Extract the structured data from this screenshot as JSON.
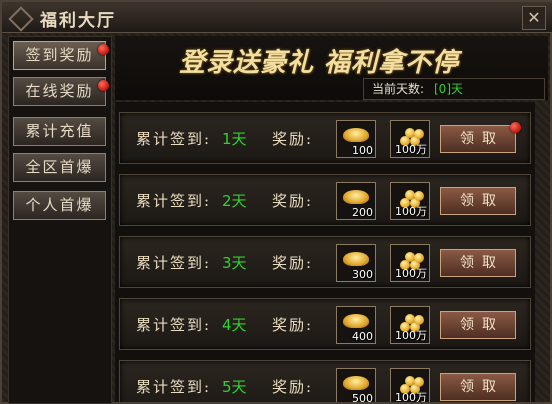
{
  "window": {
    "title": "福利大厅"
  },
  "nav": {
    "items": [
      {
        "label": "签到奖励",
        "badge": true
      },
      {
        "label": "在线奖励",
        "badge": true
      },
      {
        "label": "累计充值",
        "badge": false
      },
      {
        "label": "全区首爆",
        "badge": false
      },
      {
        "label": "个人首爆",
        "badge": false
      }
    ]
  },
  "banner": {
    "slogan": "登录送豪礼 福利拿不停",
    "days_label": "当前天数:",
    "days_value": "[0]天"
  },
  "rows": [
    {
      "label": "累计签到:",
      "day": "1天",
      "reward_label": "奖励:",
      "item1_qty": "100",
      "item2_qty": "100万",
      "claim": "领取",
      "badge": true
    },
    {
      "label": "累计签到:",
      "day": "2天",
      "reward_label": "奖励:",
      "item1_qty": "200",
      "item2_qty": "100万",
      "claim": "领取",
      "badge": false
    },
    {
      "label": "累计签到:",
      "day": "3天",
      "reward_label": "奖励:",
      "item1_qty": "300",
      "item2_qty": "100万",
      "claim": "领取",
      "badge": false
    },
    {
      "label": "累计签到:",
      "day": "4天",
      "reward_label": "奖励:",
      "item1_qty": "400",
      "item2_qty": "100万",
      "claim": "领取",
      "badge": false
    },
    {
      "label": "累计签到:",
      "day": "5天",
      "reward_label": "奖励:",
      "item1_qty": "500",
      "item2_qty": "100万",
      "claim": "领取",
      "badge": false
    }
  ],
  "colors": {
    "accent_green": "#2fd22f",
    "badge_red": "#c4140c",
    "gold": "#f3dfa2"
  }
}
